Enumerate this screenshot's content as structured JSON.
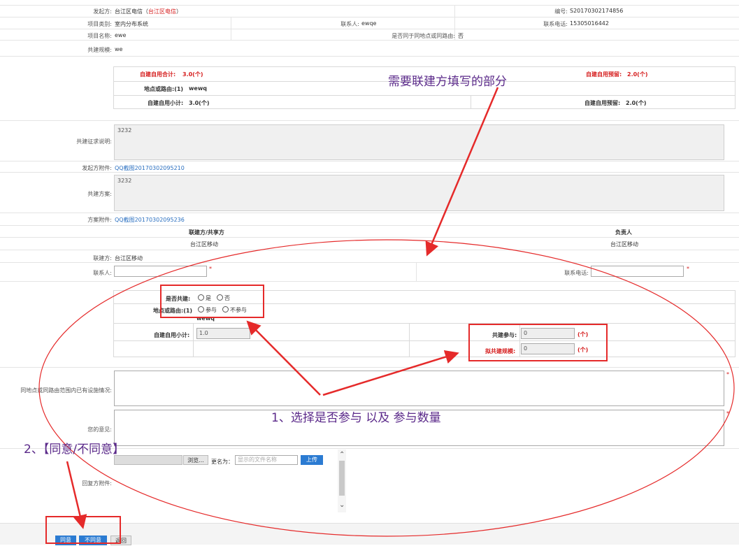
{
  "header": {
    "initiator_label": "发起方:",
    "initiator_value": "台江区电信",
    "initiator_paren_open": "（",
    "initiator_paren_value": "台江区电信",
    "initiator_paren_close": "）",
    "serial_label": "编号:",
    "serial_value": "S20170302174856",
    "project_type_label": "项目类别:",
    "project_type_value": "室内分布系统",
    "contact_label": "联系人:",
    "contact_value": "ewqe",
    "phone_label": "联系电话:",
    "phone_value": "15305016442",
    "project_name_label": "项目名称:",
    "project_name_value": "ewe",
    "same_site_label": "是否同于同地点或同路由:",
    "same_site_value": "否",
    "scale_label": "共建规模:",
    "scale_value": "we"
  },
  "summary_table": {
    "total_label": "自建自用合计:",
    "total_value": "3.0(个)",
    "reserve_label": "自建自用预留:",
    "reserve_value": "2.0(个)",
    "site_label": "地点或路由:(1)",
    "site_value": "wewq",
    "subtotal_label": "自建自用小计:",
    "subtotal_value": "3.0(个)",
    "reserve2_label": "自建自用预留:",
    "reserve2_value": "2.0(个)"
  },
  "request": {
    "desc_label": "共建征求说明:",
    "desc_value": "3232",
    "attach_label": "发起方附件:",
    "attach_value": "QQ截图20170302095210",
    "plan_label": "共建方案:",
    "plan_value": "3232",
    "plan_attach_label": "方案附件:",
    "plan_attach_value": "QQ截图20170302095236"
  },
  "partners": {
    "col_party": "联建方/共享方",
    "col_owner": "负责人",
    "party_value": "台江区移动",
    "owner_value": "台江区移动"
  },
  "joint": {
    "party_label": "联建方:",
    "party_value": "台江区移动",
    "contact_label": "联系人:",
    "contact_required": "*",
    "phone_label": "联系电话:",
    "phone_required": "*",
    "share_label": "是否共建:",
    "yes_label": "是",
    "no_label": "否",
    "site_label": "地点或路由:(1)",
    "join_label": "参与",
    "notjoin_label": "不参与",
    "site_value": "wewq",
    "subtotal_label": "自建自用小计:",
    "subtotal_value": "1.0",
    "partake_label": "共建参与:",
    "partake_value": "0",
    "partake_unit": "(个)",
    "plan_scale_label": "拟共建规模:",
    "plan_scale_value": "0",
    "plan_scale_unit": "(个)",
    "existing_label": "同地点或同路由范围内已有设施情况:",
    "existing_required": "*",
    "opinion_label": "您的意见:",
    "opinion_required": "*",
    "reply_attach_label": "回复方附件:",
    "browse_label": "浏览...",
    "rename_label": "更名为：",
    "rename_placeholder": "显示的文件名称",
    "upload_label": "上传"
  },
  "buttons": {
    "agree": "同意",
    "disagree": "不同意",
    "back": "返回"
  },
  "annotations": {
    "top_note": "需要联建方填写的部分",
    "note1": "1、选择是否参与 以及 参与数量",
    "note2": "2、【同意/不同意】",
    "color": "#e52a2a",
    "text_color": "#5b2a8a"
  }
}
